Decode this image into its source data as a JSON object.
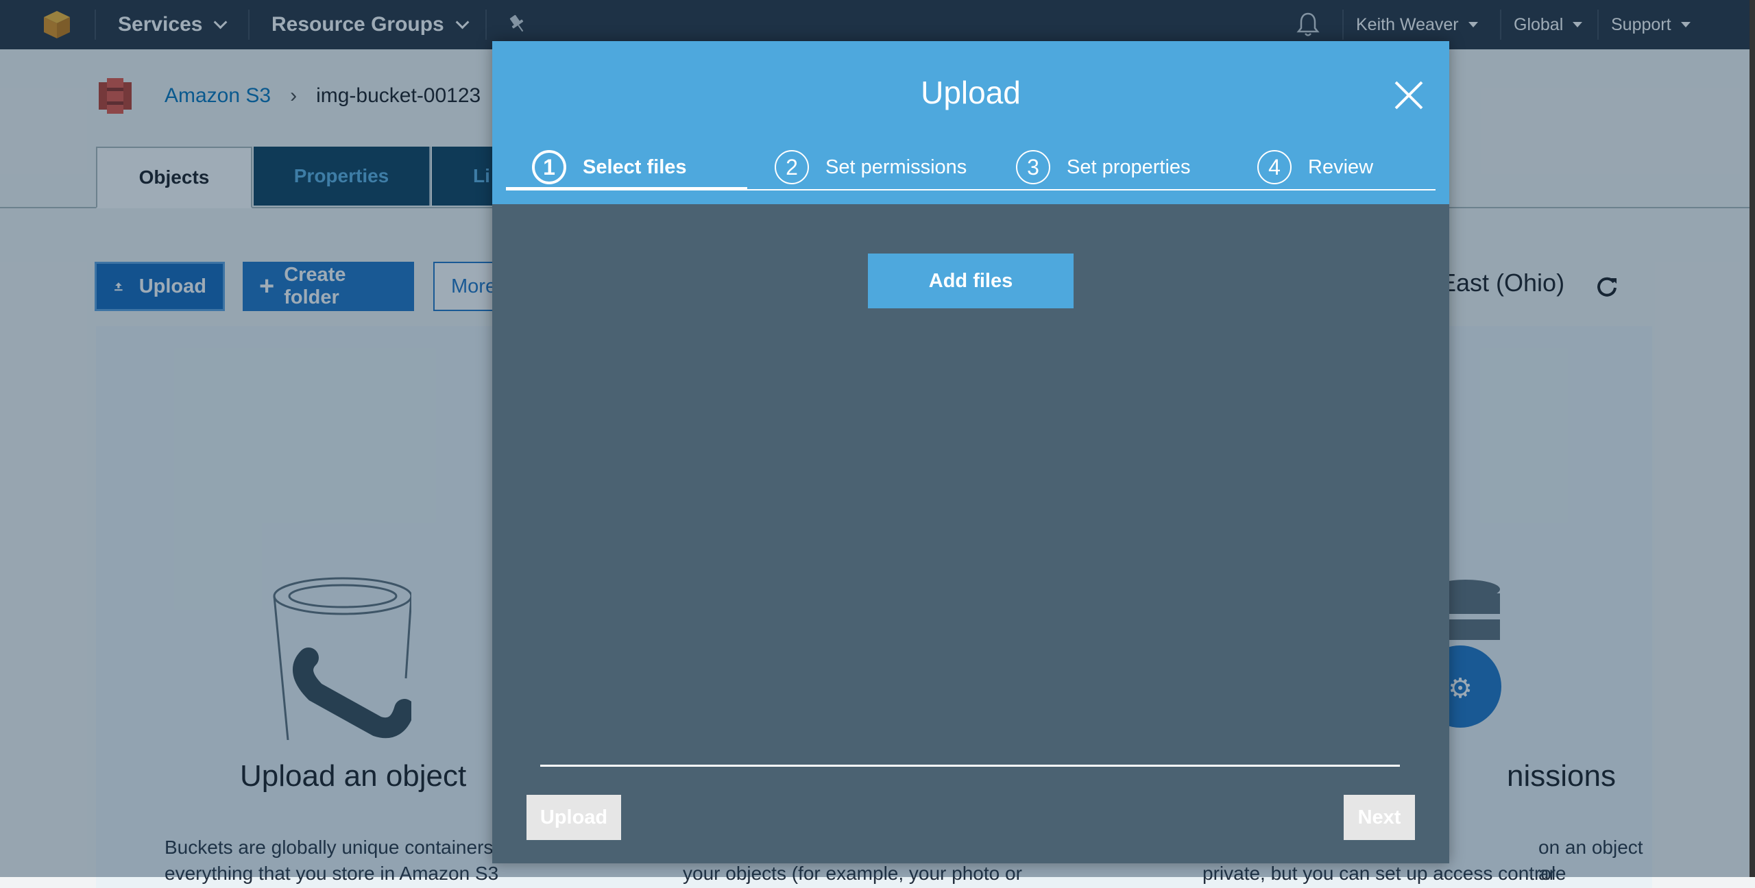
{
  "nav": {
    "services": "Services",
    "resource_groups": "Resource Groups",
    "user": "Keith Weaver",
    "region": "Global",
    "support": "Support"
  },
  "breadcrumb": {
    "root": "Amazon S3",
    "current": "img-bucket-00123"
  },
  "tabs": [
    "Objects",
    "Properties",
    "Li"
  ],
  "toolbar": {
    "upload": "Upload",
    "create_folder": "Create folder",
    "more": "More"
  },
  "region_label": "East (Ohio)",
  "cards": {
    "left_title": "Upload an object",
    "left_text_1": "Buckets are globally unique containers",
    "left_text_2": "everything that you store in Amazon S3",
    "mid_text": "your objects (for example, your photo or",
    "right_title": "nissions",
    "right_text_1": "on an object are",
    "right_text_2": "private, but you can set up access control"
  },
  "modal": {
    "title": "Upload",
    "steps": [
      {
        "num": "1",
        "label": "Select files"
      },
      {
        "num": "2",
        "label": "Set permissions"
      },
      {
        "num": "3",
        "label": "Set properties"
      },
      {
        "num": "4",
        "label": "Review"
      }
    ],
    "add_files": "Add files",
    "upload_button": "Upload",
    "next_button": "Next"
  },
  "colors": {
    "nav_bg": "#232f3e",
    "modal_header": "#4ea8dd",
    "modal_body": "#4b6272",
    "aws_orange": "#f7a21b",
    "s3_red": "#e25444"
  }
}
